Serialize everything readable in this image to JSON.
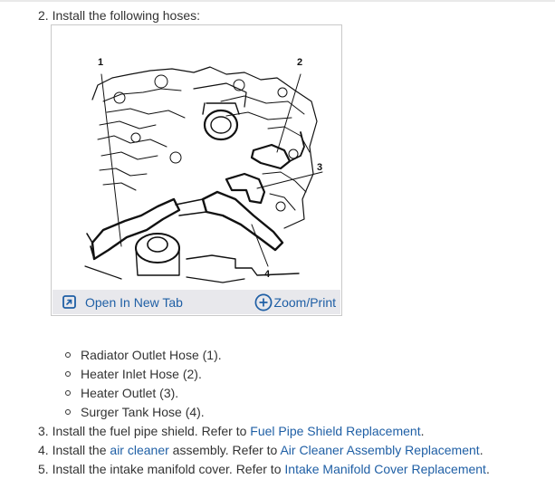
{
  "step2": {
    "number": "2.",
    "text": "Install the following hoses:"
  },
  "figure": {
    "callouts": [
      "1",
      "2",
      "3",
      "4"
    ],
    "toolbar": {
      "open_label": "Open In New Tab",
      "zoom_label": "Zoom/Print",
      "open_icon": "open-in-new-tab-icon",
      "zoom_icon": "plus-circle-icon"
    }
  },
  "hoses": [
    "Radiator Outlet Hose (1).",
    "Heater Inlet Hose (2).",
    "Heater Outlet  (3).",
    "Surger Tank Hose (4)."
  ],
  "step3": {
    "number": "3.",
    "text": "Install the fuel pipe shield. Refer to ",
    "link": "Fuel Pipe Shield Replacement",
    "end": "."
  },
  "step4": {
    "number": "4.",
    "text_a": "Install the ",
    "link_a": "air cleaner",
    "text_b": " assembly. Refer to ",
    "link_b": "Air Cleaner Assembly Replacement",
    "end": "."
  },
  "step5": {
    "number": "5.",
    "text": "Install the intake manifold cover. Refer to ",
    "link": "Intake Manifold Cover Replacement",
    "end": "."
  },
  "colors": {
    "text": "#333333",
    "link": "#1f5fa5",
    "toolbar_bg": "#e8e8ec",
    "border": "#c9c9c9"
  }
}
